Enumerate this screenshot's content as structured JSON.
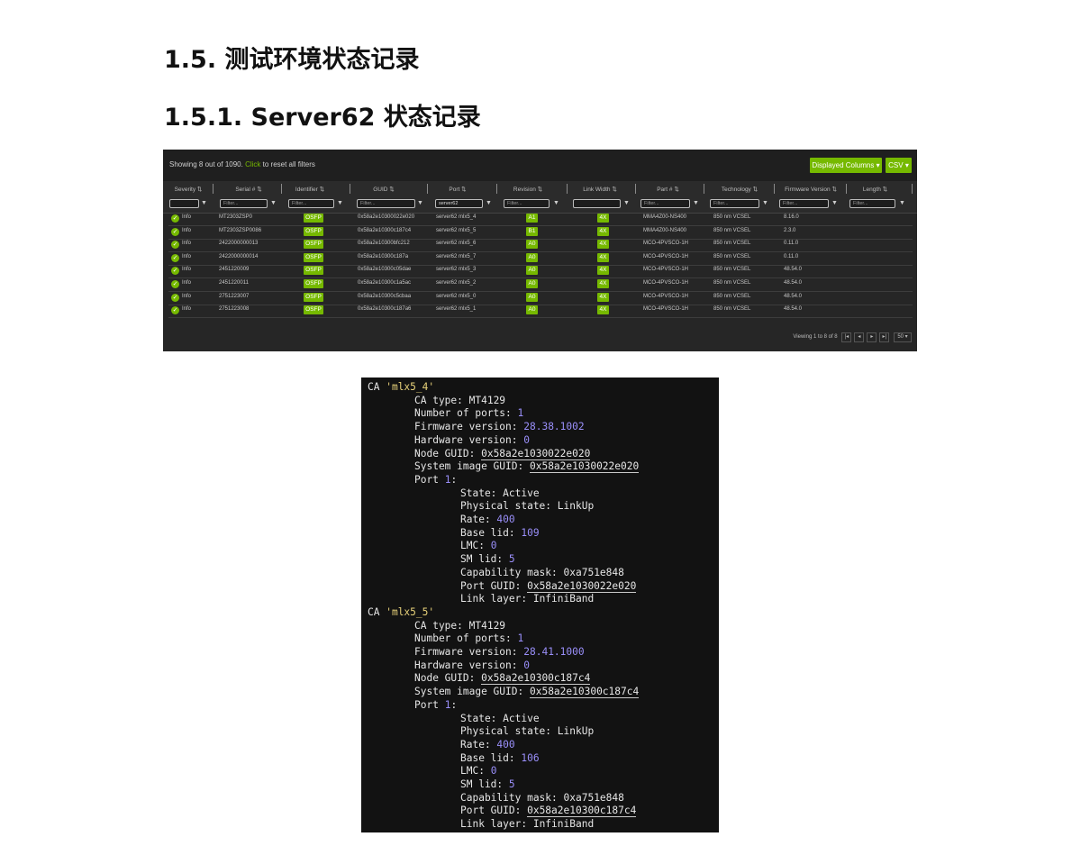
{
  "doc": {
    "heading1": "1.5.  测试环境状态记录",
    "heading2": "1.5.1. Server62 状态记录"
  },
  "grid": {
    "showing_text": "Showing 8 out of 1090.",
    "click_text": "Click",
    "reset_text": "to reset all filters",
    "displayed_columns": "Displayed Columns ▾",
    "csv": "CSV ▾",
    "columns": [
      "Severity ⇅",
      "Serial # ⇅",
      "Identifier ⇅",
      "GUID ⇅",
      "Port ⇅",
      "Revision ⇅",
      "Link Width ⇅",
      "Part # ⇅",
      "Technology ⇅",
      "Firmware Version ⇅",
      "Length ⇅"
    ],
    "filter_placeholder": "Filter...",
    "port_filter_value": "server62",
    "rows": [
      {
        "severity": "Info",
        "serial": "MT2303ZSP0",
        "identifier": "OSFP",
        "guid": "0x58a2e10300022e020",
        "port": "server62 mlx5_4",
        "revision": "A1",
        "width": "4X",
        "part": "MMA4Z00-NS400",
        "tech": "850 nm VCSEL",
        "fw": "8.16.0"
      },
      {
        "severity": "Info",
        "serial": "MT2303ZSP0086",
        "identifier": "OSFP",
        "guid": "0x58a2e10300c187c4",
        "port": "server62 mlx5_5",
        "revision": "B1",
        "width": "4X",
        "part": "MMA4Z00-NS400",
        "tech": "850 nm VCSEL",
        "fw": "2.3.0"
      },
      {
        "severity": "Info",
        "serial": "2422000000013",
        "identifier": "OSFP",
        "guid": "0x58a2e10300bfc212",
        "port": "server62 mlx5_6",
        "revision": "A0",
        "width": "4X",
        "part": "MCO-4PVSCO-1H",
        "tech": "850 nm VCSEL",
        "fw": "0.11.0"
      },
      {
        "severity": "Info",
        "serial": "2422000000014",
        "identifier": "OSFP",
        "guid": "0x58a2e10300c187a",
        "port": "server62 mlx5_7",
        "revision": "A0",
        "width": "4X",
        "part": "MCO-4PVSCO-1H",
        "tech": "850 nm VCSEL",
        "fw": "0.11.0"
      },
      {
        "severity": "Info",
        "serial": "2451220009",
        "identifier": "OSFP",
        "guid": "0x58a2e10300c05dae",
        "port": "server62 mlx5_3",
        "revision": "A0",
        "width": "4X",
        "part": "MCO-4PVSCO-1H",
        "tech": "850 nm VCSEL",
        "fw": "48.54.0"
      },
      {
        "severity": "Info",
        "serial": "2451220011",
        "identifier": "OSFP",
        "guid": "0x58a2e10300c1a5ac",
        "port": "server62 mlx5_2",
        "revision": "A0",
        "width": "4X",
        "part": "MCO-4PVSCO-1H",
        "tech": "850 nm VCSEL",
        "fw": "48.54.0"
      },
      {
        "severity": "Info",
        "serial": "2751223007",
        "identifier": "OSFP",
        "guid": "0x58a2e10300c5cbaa",
        "port": "server62 mlx5_0",
        "revision": "A0",
        "width": "4X",
        "part": "MCO-4PVSCO-1H",
        "tech": "850 nm VCSEL",
        "fw": "48.54.0"
      },
      {
        "severity": "Info",
        "serial": "2751223008",
        "identifier": "OSFP",
        "guid": "0x58a2e10300c187a6",
        "port": "server62 mlx5_1",
        "revision": "A0",
        "width": "4X",
        "part": "MCO-4PVSCO-1H",
        "tech": "850 nm VCSEL",
        "fw": "48.54.0"
      }
    ],
    "pager_text": "Viewing 1 to 8 of 8",
    "page_size": "50 ▾"
  },
  "terminal": {
    "cas": [
      {
        "name": "'mlx5_4'",
        "ca_type": "MT4129",
        "num_ports": "1",
        "fw": "28.38.1002",
        "hw": "0",
        "node_guid": "0x58a2e1030022e020",
        "sys_guid": "0x58a2e1030022e020",
        "port": "1",
        "state": "Active",
        "phys": "LinkUp",
        "rate": "400",
        "base_lid": "109",
        "lmc": "0",
        "sm_lid": "5",
        "cap_mask": "0xa751e848",
        "port_guid": "0x58a2e1030022e020",
        "link_layer": "InfiniBand"
      },
      {
        "name": "'mlx5_5'",
        "ca_type": "MT4129",
        "num_ports": "1",
        "fw": "28.41.1000",
        "hw": "0",
        "node_guid": "0x58a2e10300c187c4",
        "sys_guid": "0x58a2e10300c187c4",
        "port": "1",
        "state": "Active",
        "phys": "LinkUp",
        "rate": "400",
        "base_lid": "106",
        "lmc": "0",
        "sm_lid": "5",
        "cap_mask": "0xa751e848",
        "port_guid": "0x58a2e10300c187c4",
        "link_layer": "InfiniBand"
      }
    ]
  }
}
